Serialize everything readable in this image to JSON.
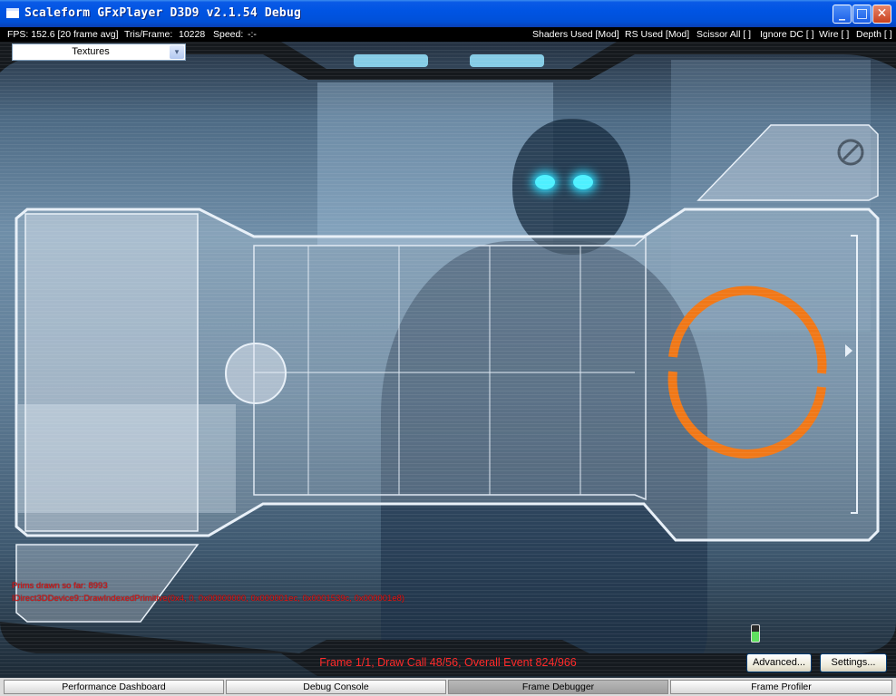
{
  "window": {
    "title": "Scaleform GFxPlayer D3D9 v2.1.54 Debug",
    "minimize_glyph": "_",
    "maximize_glyph": "□",
    "close_glyph": "✕"
  },
  "stats": {
    "fps": "FPS: 152.6 [20 frame avg]",
    "tris_label": "Tris/Frame:",
    "tris_value": "10228",
    "speed_label": "Speed:",
    "speed_value": "-:-",
    "shaders": "Shaders Used [Mod]",
    "rs": "RS Used [Mod]",
    "scissor": "Scissor All [ ]",
    "ignore_dc": "Ignore DC [ ]",
    "wire": "Wire [ ]",
    "depth": "Depth [ ]"
  },
  "view_select": {
    "value": "Textures",
    "arrow_glyph": "▾"
  },
  "debug_overlay": {
    "prims": "Prims drawn so far: 8993",
    "call": "IDirect3DDevice9::DrawIndexedPrimitive(0x4, 0, 0x00000000, 0x000001ec, 0x0001539c, 0x000001e8)"
  },
  "frame_info": "Frame 1/1, Draw Call 48/56, Overall Event 824/966",
  "buttons": {
    "advanced": "Advanced...",
    "settings": "Settings..."
  },
  "tabs": [
    "Performance Dashboard",
    "Debug Console",
    "Frame Debugger",
    "Frame Profiler"
  ],
  "active_tab": "Frame Debugger",
  "colors": {
    "title_bar": "#0054e3",
    "hud_ring": "#f07818",
    "overlay_text": "#e01818",
    "hud_stroke": "#e8f0f8"
  }
}
